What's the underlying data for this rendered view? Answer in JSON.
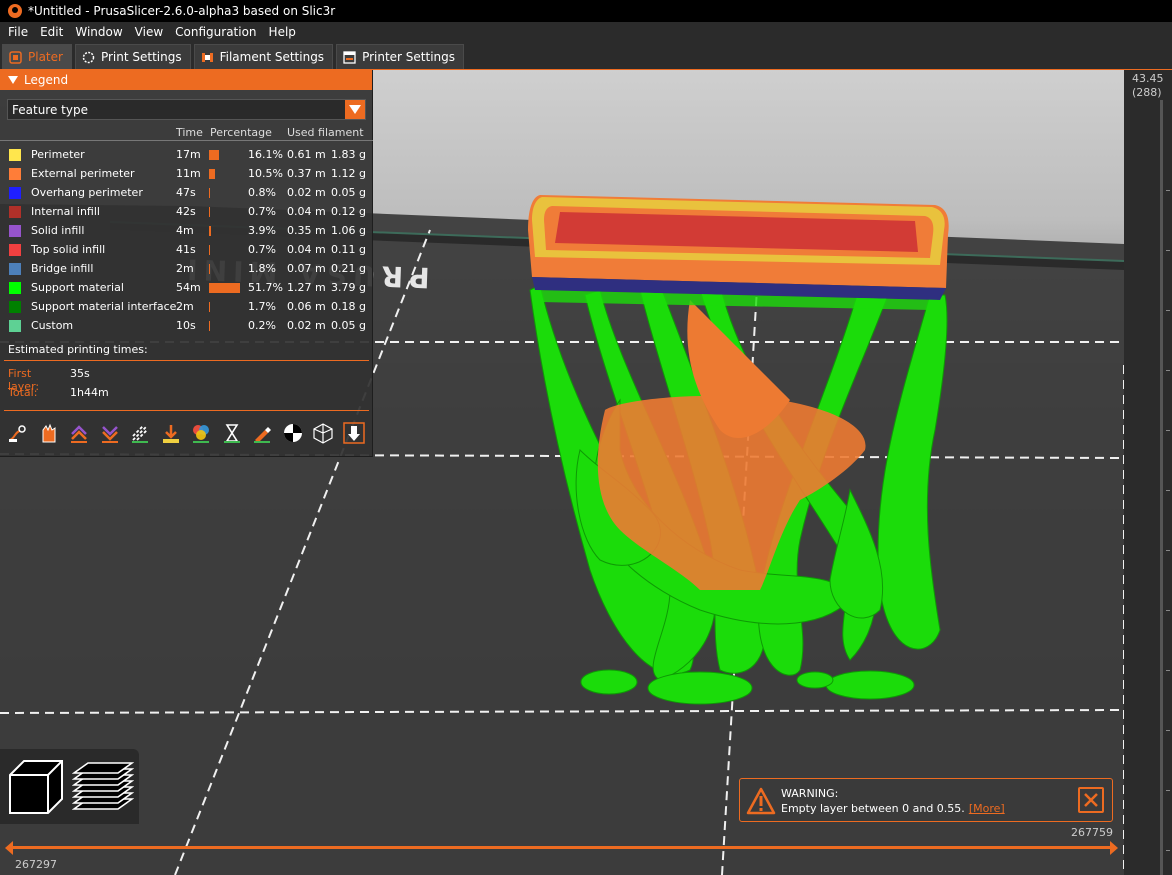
{
  "window": {
    "title": "*Untitled - PrusaSlicer-2.6.0-alpha3 based on Slic3r"
  },
  "menu": [
    "File",
    "Edit",
    "Window",
    "View",
    "Configuration",
    "Help"
  ],
  "tabs": [
    {
      "label": "Plater",
      "active": true
    },
    {
      "label": "Print Settings",
      "active": false
    },
    {
      "label": "Filament Settings",
      "active": false
    },
    {
      "label": "Printer Settings",
      "active": false
    }
  ],
  "legend": {
    "title": "Legend",
    "view_type": "Feature type",
    "columns": {
      "time": "Time",
      "percentage": "Percentage",
      "used": "Used filament"
    },
    "rows": [
      {
        "name": "Perimeter",
        "color": "#FFE64D",
        "time": "17m",
        "pct": "16.1%",
        "pct_value": 0.161,
        "length": "0.61 m",
        "weight": "1.83 g"
      },
      {
        "name": "External perimeter",
        "color": "#FF7D38",
        "time": "11m",
        "pct": "10.5%",
        "pct_value": 0.105,
        "length": "0.37 m",
        "weight": "1.12 g"
      },
      {
        "name": "Overhang perimeter",
        "color": "#1F1FFF",
        "time": "47s",
        "pct": "0.8%",
        "pct_value": 0.008,
        "length": "0.02 m",
        "weight": "0.05 g"
      },
      {
        "name": "Internal infill",
        "color": "#B03029",
        "time": "42s",
        "pct": "0.7%",
        "pct_value": 0.007,
        "length": "0.04 m",
        "weight": "0.12 g"
      },
      {
        "name": "Solid infill",
        "color": "#9654CC",
        "time": "4m",
        "pct": "3.9%",
        "pct_value": 0.039,
        "length": "0.35 m",
        "weight": "1.06 g"
      },
      {
        "name": "Top solid infill",
        "color": "#F04040",
        "time": "41s",
        "pct": "0.7%",
        "pct_value": 0.007,
        "length": "0.04 m",
        "weight": "0.11 g"
      },
      {
        "name": "Bridge infill",
        "color": "#4D80BA",
        "time": "2m",
        "pct": "1.8%",
        "pct_value": 0.018,
        "length": "0.07 m",
        "weight": "0.21 g"
      },
      {
        "name": "Support material",
        "color": "#00FF00",
        "time": "54m",
        "pct": "51.7%",
        "pct_value": 0.517,
        "length": "1.27 m",
        "weight": "3.79 g"
      },
      {
        "name": "Support material interface",
        "color": "#008000",
        "time": "2m",
        "pct": "1.7%",
        "pct_value": 0.017,
        "length": "0.06 m",
        "weight": "0.18 g"
      },
      {
        "name": "Custom",
        "color": "#5ED194",
        "time": "10s",
        "pct": "0.2%",
        "pct_value": 0.002,
        "length": "0.02 m",
        "weight": "0.05 g"
      }
    ],
    "estimated_title": "Estimated printing times:",
    "first_layer_label": "First layer:",
    "first_layer_value": "35s",
    "total_label": "Total:",
    "total_value": "1h44m",
    "tool_icons": [
      "travel-icon",
      "wipe-icon",
      "retractions-icon",
      "deretractions-icon",
      "seams-icon",
      "tool-changes-icon",
      "color-changes-icon",
      "pause-icon",
      "custom-gcode-icon",
      "center-of-gravity-icon",
      "shells-icon",
      "tool-marker-icon"
    ]
  },
  "bed": {
    "text": "PRUSA MINI"
  },
  "vslider": {
    "top_value": "43.45",
    "top_layer": "(288)"
  },
  "hslider": {
    "top_value": "267759",
    "bottom_value": "267297"
  },
  "warning": {
    "title": "WARNING:",
    "text": "Empty layer between 0 and 0.55.",
    "link": "[More]"
  },
  "colors": {
    "accent": "#ED6B21",
    "support": "#00FF00",
    "external_perimeter": "#FF7D38",
    "top_solid": "#D23B35"
  }
}
